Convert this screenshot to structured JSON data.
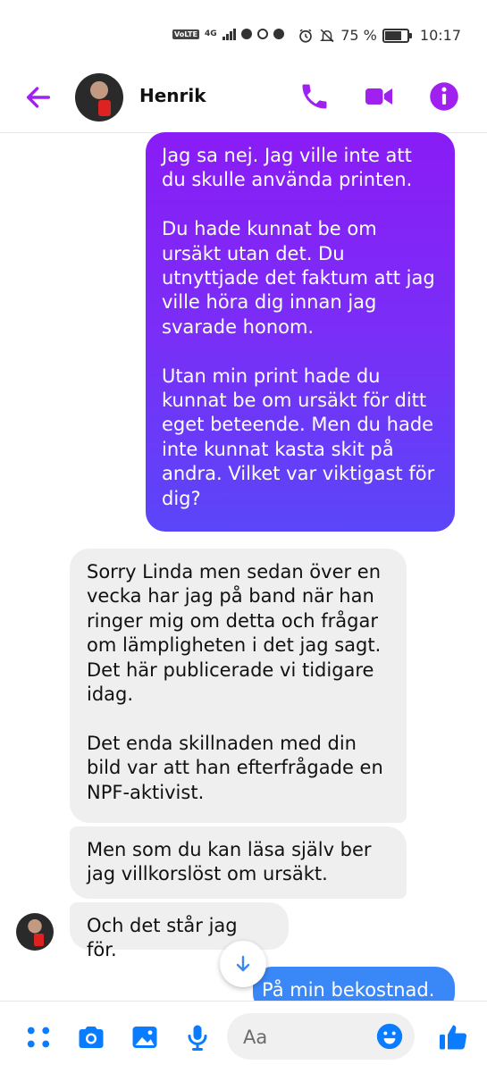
{
  "status_bar": {
    "volte": "VoLTE",
    "network": "4G",
    "battery_text": "75 %",
    "battery_level": 0.75,
    "time": "10:17"
  },
  "header": {
    "contact_name": "Henrik",
    "accent_color": "#a020f0"
  },
  "messages": [
    {
      "direction": "sent",
      "text": "Jag sa nej. Jag ville inte att du skulle använda printen.\n\nDu hade kunnat be om ursäkt utan det. Du utnyttjade det faktum att jag ville höra dig innan jag svarade honom.\n\nUtan min print hade du kunnat be om ursäkt för ditt eget beteende. Men du hade inte kunnat kasta skit på andra. Vilket var viktigast för dig?"
    },
    {
      "direction": "received",
      "text": "Sorry Linda men sedan över en vecka har jag på band när han ringer mig om detta och frågar om lämpligheten i det jag sagt. Det här publicerade vi tidigare idag.\n\nDet enda skillnaden med din bild var att han efterfrågade en NPF-aktivist."
    },
    {
      "direction": "received",
      "text": "Men som du kan läsa själv ber jag villkorslöst om ursäkt."
    },
    {
      "direction": "received",
      "text": "Och det står jag för."
    },
    {
      "direction": "sent",
      "text": "På min bekostnad."
    }
  ],
  "composer": {
    "placeholder": "Aa"
  },
  "icons": [
    "back-arrow-icon",
    "phone-icon",
    "video-icon",
    "info-icon",
    "menu-dots-icon",
    "camera-icon",
    "gallery-icon",
    "microphone-icon",
    "emoji-icon",
    "thumbs-up-icon",
    "arrow-down-icon"
  ]
}
